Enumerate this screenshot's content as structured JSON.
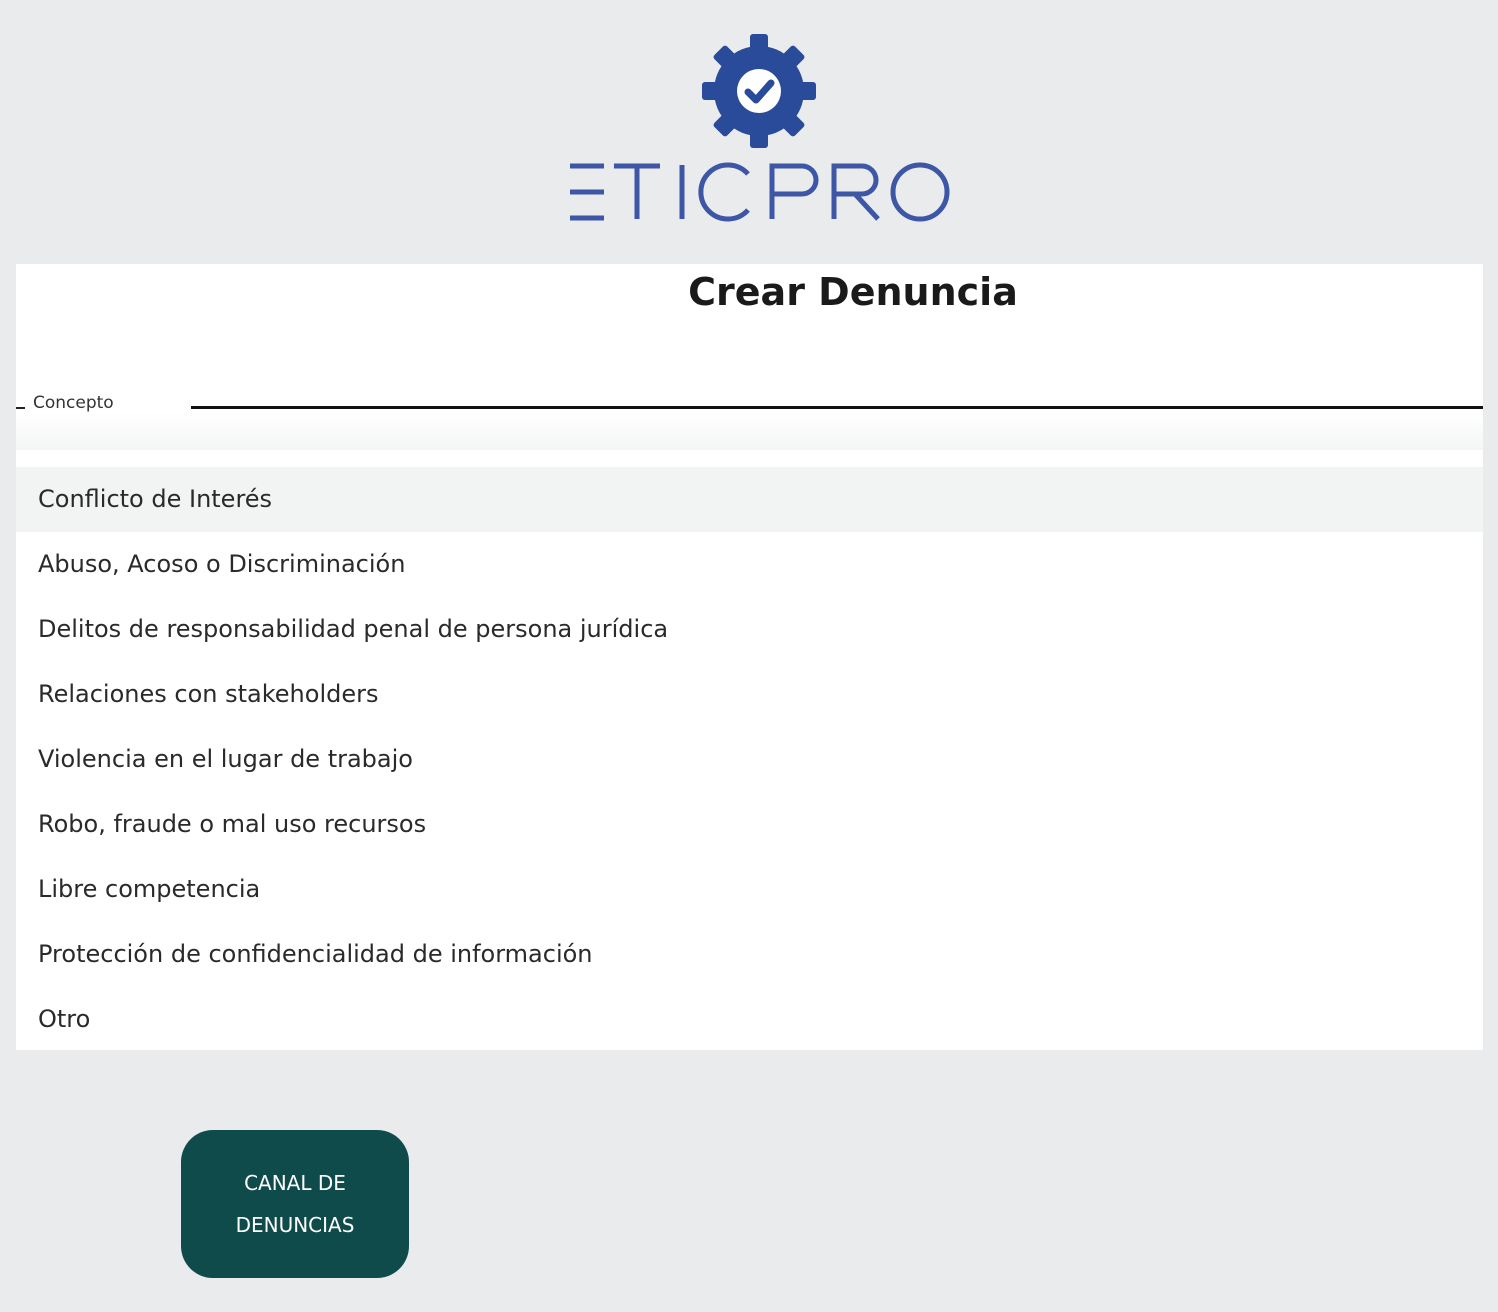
{
  "brand": {
    "logo_text": "ETICPRO",
    "logo_color": "#2A4B9A"
  },
  "form": {
    "title": "Crear Denuncia",
    "concepto_label": "Concepto"
  },
  "concepto_options": [
    {
      "label": "Conflicto de Interés",
      "highlighted": true
    },
    {
      "label": "Abuso, Acoso o Discriminación",
      "highlighted": false
    },
    {
      "label": "Delitos de responsabilidad penal de persona jurídica",
      "highlighted": false
    },
    {
      "label": "Relaciones con stakeholders",
      "highlighted": false
    },
    {
      "label": "Violencia en el lugar de trabajo",
      "highlighted": false
    },
    {
      "label": "Robo, fraude o mal uso recursos",
      "highlighted": false
    },
    {
      "label": "Libre competencia",
      "highlighted": false
    },
    {
      "label": "Protección de confidencialidad de información",
      "highlighted": false
    },
    {
      "label": "Otro",
      "highlighted": false
    }
  ],
  "canal_button": {
    "line1": "CANAL DE",
    "line2": "DENUNCIAS",
    "color": "#0F4B4A"
  },
  "colors": {
    "background": "#EAEBED",
    "panel": "#FFFFFF",
    "highlight": "#F2F3F3"
  }
}
